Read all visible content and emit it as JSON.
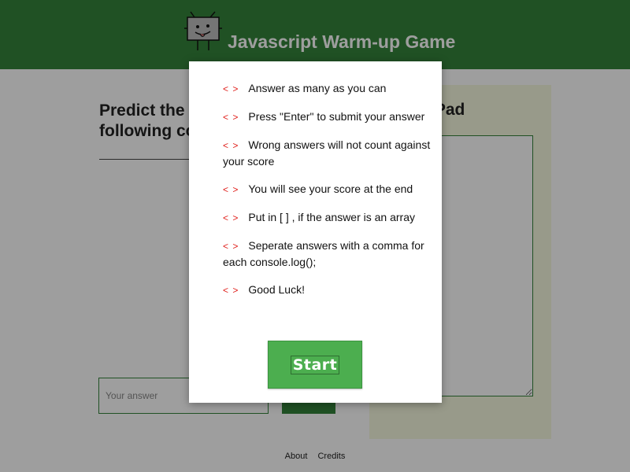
{
  "header": {
    "title": "Javascript Warm-up Game",
    "mascot_icon": "tv-robot-mascot-icon"
  },
  "left_panel": {
    "prompt": "Predict the output of the following code",
    "input_placeholder": "Your answer"
  },
  "right_panel": {
    "title": "Scratch Pad"
  },
  "footer": {
    "links": [
      "About",
      "Credits"
    ]
  },
  "modal": {
    "rule_marker": "< >",
    "rules": [
      "Answer as many as you can",
      "Press \"Enter\" to submit your answer",
      "Wrong answers will not count against your score",
      "You will see your score at the end",
      "Put in [ ] , if the answer is an array",
      "Seperate answers with a comma for each console.log();",
      "Good Luck!"
    ],
    "start_label": "Start"
  },
  "colors": {
    "header_green": "#35843a",
    "button_green": "#4cae4f",
    "marker_red": "#e0201c",
    "scratch_bg": "#f5f8df"
  }
}
